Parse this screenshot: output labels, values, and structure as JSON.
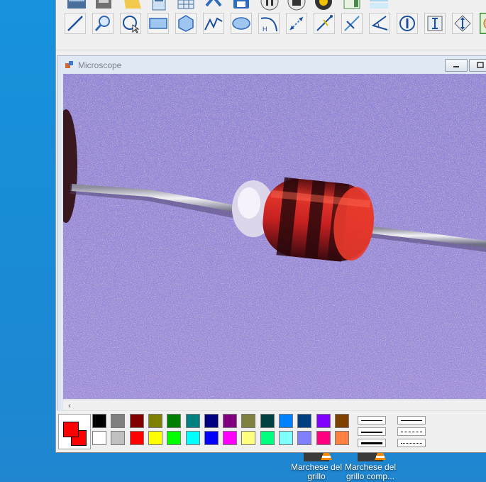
{
  "child_window": {
    "title": "Microscope"
  },
  "toolbar": {
    "top_row": [
      "film-icon",
      "box-icon",
      "folder-icon",
      "document-icon",
      "grid-icon",
      "arrow-icon",
      "save-icon",
      "pause-icon",
      "stop-icon",
      "record-icon",
      "panel-icon",
      "strip-icon"
    ],
    "tools": [
      "line-tool",
      "magnifier-tool",
      "circle-select-tool",
      "rectangle-tool",
      "polygon-tool",
      "polyline-tool",
      "ellipse-tool",
      "arc-tool",
      "dimension-tool",
      "angle-measure-tool",
      "calibrate-tool",
      "angle-tool",
      "circle-info-tool",
      "text-tool",
      "vertical-measure-tool",
      "extra-tool"
    ]
  },
  "palette": {
    "current_foreground": "#ff0000",
    "current_background": "#ff0000",
    "row1": [
      "#000000",
      "#808080",
      "#800000",
      "#808000",
      "#008000",
      "#008080",
      "#000080",
      "#800080",
      "#808040",
      "#004040",
      "#0080ff",
      "#004080",
      "#8000ff",
      "#804000"
    ],
    "row2": [
      "#ffffff",
      "#c0c0c0",
      "#ff0000",
      "#ffff00",
      "#00ff00",
      "#00ffff",
      "#0000ff",
      "#ff00ff",
      "#ffff80",
      "#00ff80",
      "#80ffff",
      "#8080ff",
      "#ff0080",
      "#ff8040"
    ]
  },
  "desktop_icons": [
    {
      "label_line1": "Marchese del",
      "label_line2": "grillo"
    },
    {
      "label_line1": "Marchese del",
      "label_line2": "grillo comp..."
    }
  ],
  "colors": {
    "desktop": "#1e8fd8",
    "window_bg": "#f0f0f0",
    "child_title_bg": "#dfe8f3"
  }
}
